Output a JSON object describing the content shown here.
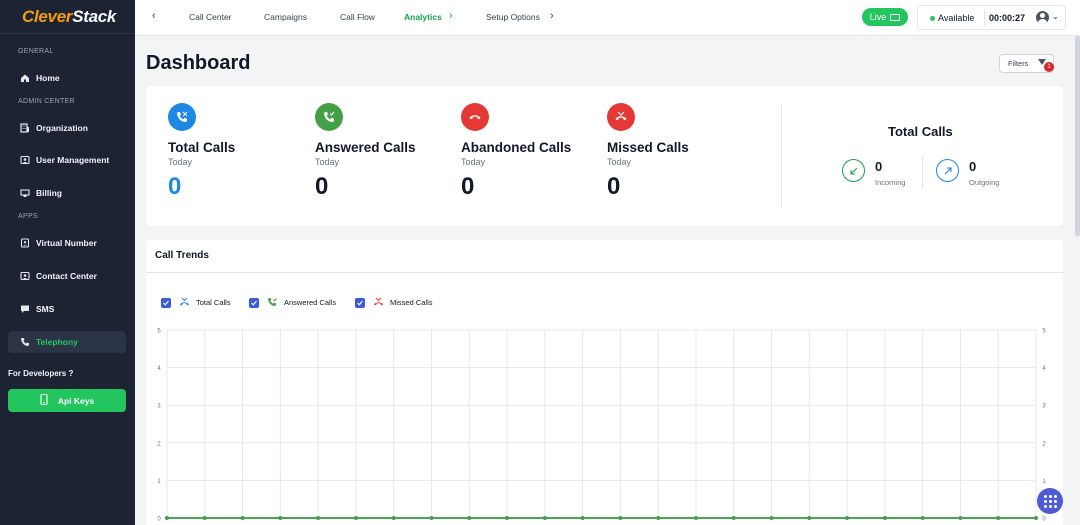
{
  "brand": {
    "part1": "Clever",
    "part2": "Stack"
  },
  "sidebar": {
    "general_label": "GENERAL",
    "admin_label": "ADMIN CENTER",
    "apps_label": "APPS",
    "items": [
      {
        "label": "Home",
        "icon": "home-icon"
      },
      {
        "label": "Organization",
        "icon": "building-icon"
      },
      {
        "label": "User Management",
        "icon": "users-icon"
      },
      {
        "label": "Billing",
        "icon": "billing-icon"
      },
      {
        "label": "Virtual Number",
        "icon": "contact-card-icon"
      },
      {
        "label": "Contact Center",
        "icon": "contact-center-icon"
      },
      {
        "label": "SMS",
        "icon": "chat-icon"
      },
      {
        "label": "Telephony",
        "icon": "phone-icon",
        "active": true
      }
    ],
    "developers_label": "For Developers ?",
    "api_keys_label": "Api Keys"
  },
  "topnav": {
    "items": [
      "Call Center",
      "Campaigns",
      "Call Flow",
      "Analytics",
      "Setup Options"
    ],
    "active": "Analytics",
    "live_label": "Live",
    "status": "Available",
    "timer": "00:00:27"
  },
  "page": {
    "title": "Dashboard",
    "filters_label": "Filters",
    "filters_count": "1"
  },
  "stats": [
    {
      "label": "Total Calls",
      "sub": "Today",
      "value": "0",
      "color": "#1e88e5"
    },
    {
      "label": "Answered Calls",
      "sub": "Today",
      "value": "0",
      "color": "#43a047"
    },
    {
      "label": "Abandoned Calls",
      "sub": "Today",
      "value": "0",
      "color": "#e53935"
    },
    {
      "label": "Missed Calls",
      "sub": "Today",
      "value": "0",
      "color": "#e53935"
    }
  ],
  "total_calls": {
    "title": "Total Calls",
    "incoming": {
      "value": "0",
      "label": "Incoming",
      "color": "#16a34a"
    },
    "outgoing": {
      "value": "0",
      "label": "Outgoing",
      "color": "#1e88e5"
    }
  },
  "trends": {
    "title": "Call Trends",
    "legend": [
      "Total Calls",
      "Answered Calls",
      "Missed Calls"
    ]
  },
  "chart_data": {
    "type": "line",
    "title": "Call Trends",
    "ylim": [
      0,
      5
    ],
    "yticks": [
      0,
      1,
      2,
      3,
      4,
      5
    ],
    "grid": true,
    "legend_position": "top-left",
    "series": [
      {
        "name": "Total Calls",
        "color": "#1e88e5",
        "values": [
          0,
          0,
          0,
          0,
          0,
          0,
          0,
          0,
          0,
          0,
          0,
          0,
          0,
          0,
          0,
          0,
          0,
          0,
          0,
          0,
          0,
          0,
          0,
          0
        ]
      },
      {
        "name": "Answered Calls",
        "color": "#43a047",
        "values": [
          0,
          0,
          0,
          0,
          0,
          0,
          0,
          0,
          0,
          0,
          0,
          0,
          0,
          0,
          0,
          0,
          0,
          0,
          0,
          0,
          0,
          0,
          0,
          0
        ]
      },
      {
        "name": "Missed Calls",
        "color": "#e53935",
        "values": [
          0,
          0,
          0,
          0,
          0,
          0,
          0,
          0,
          0,
          0,
          0,
          0,
          0,
          0,
          0,
          0,
          0,
          0,
          0,
          0,
          0,
          0,
          0,
          0
        ]
      }
    ]
  }
}
